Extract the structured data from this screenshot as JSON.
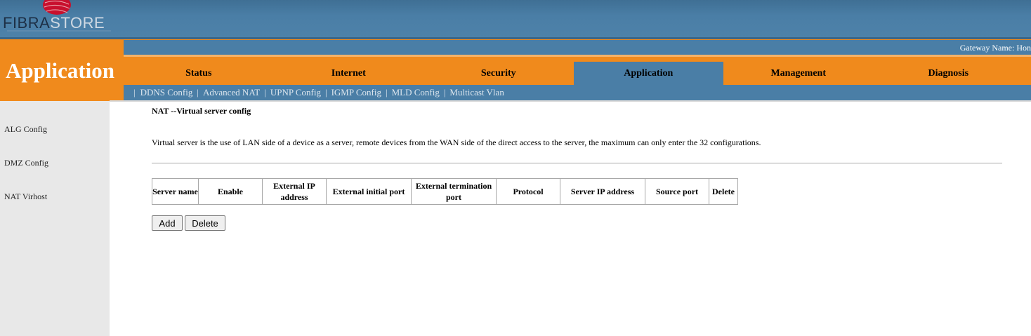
{
  "header": {
    "logo_part1": "FIBRA",
    "logo_part2": "STORE",
    "gateway_text": "Gateway Name: Hon"
  },
  "page_title": "Application",
  "nav": {
    "tabs": [
      {
        "label": "Status"
      },
      {
        "label": "Internet"
      },
      {
        "label": "Security"
      },
      {
        "label": "Application",
        "active": true
      },
      {
        "label": "Management"
      },
      {
        "label": "Diagnosis"
      }
    ]
  },
  "subnav": {
    "separator": "|",
    "items": [
      "DDNS Config",
      "Advanced NAT",
      "UPNP Config",
      "IGMP Config",
      "MLD Config",
      "Multicast Vlan"
    ]
  },
  "sidebar": {
    "items": [
      "ALG Config",
      "DMZ Config",
      "NAT Virhost"
    ]
  },
  "content": {
    "section_title": "NAT --Virtual server config",
    "description": "Virtual server is the use of LAN side of a device as a server, remote devices from the WAN side of the direct access to the server, the maximum can only enter the 32 configurations.",
    "table_headers": [
      "Server name",
      "Enable",
      "External IP address",
      "External initial port",
      "External termination port",
      "Protocol",
      "Server IP address",
      "Source port",
      "Delete"
    ],
    "add_label": "Add",
    "delete_label": "Delete"
  },
  "colors": {
    "header_blue": "#4a7ea6",
    "accent_orange": "#f08a1c",
    "sidebar_gray": "#e8e8e8"
  }
}
